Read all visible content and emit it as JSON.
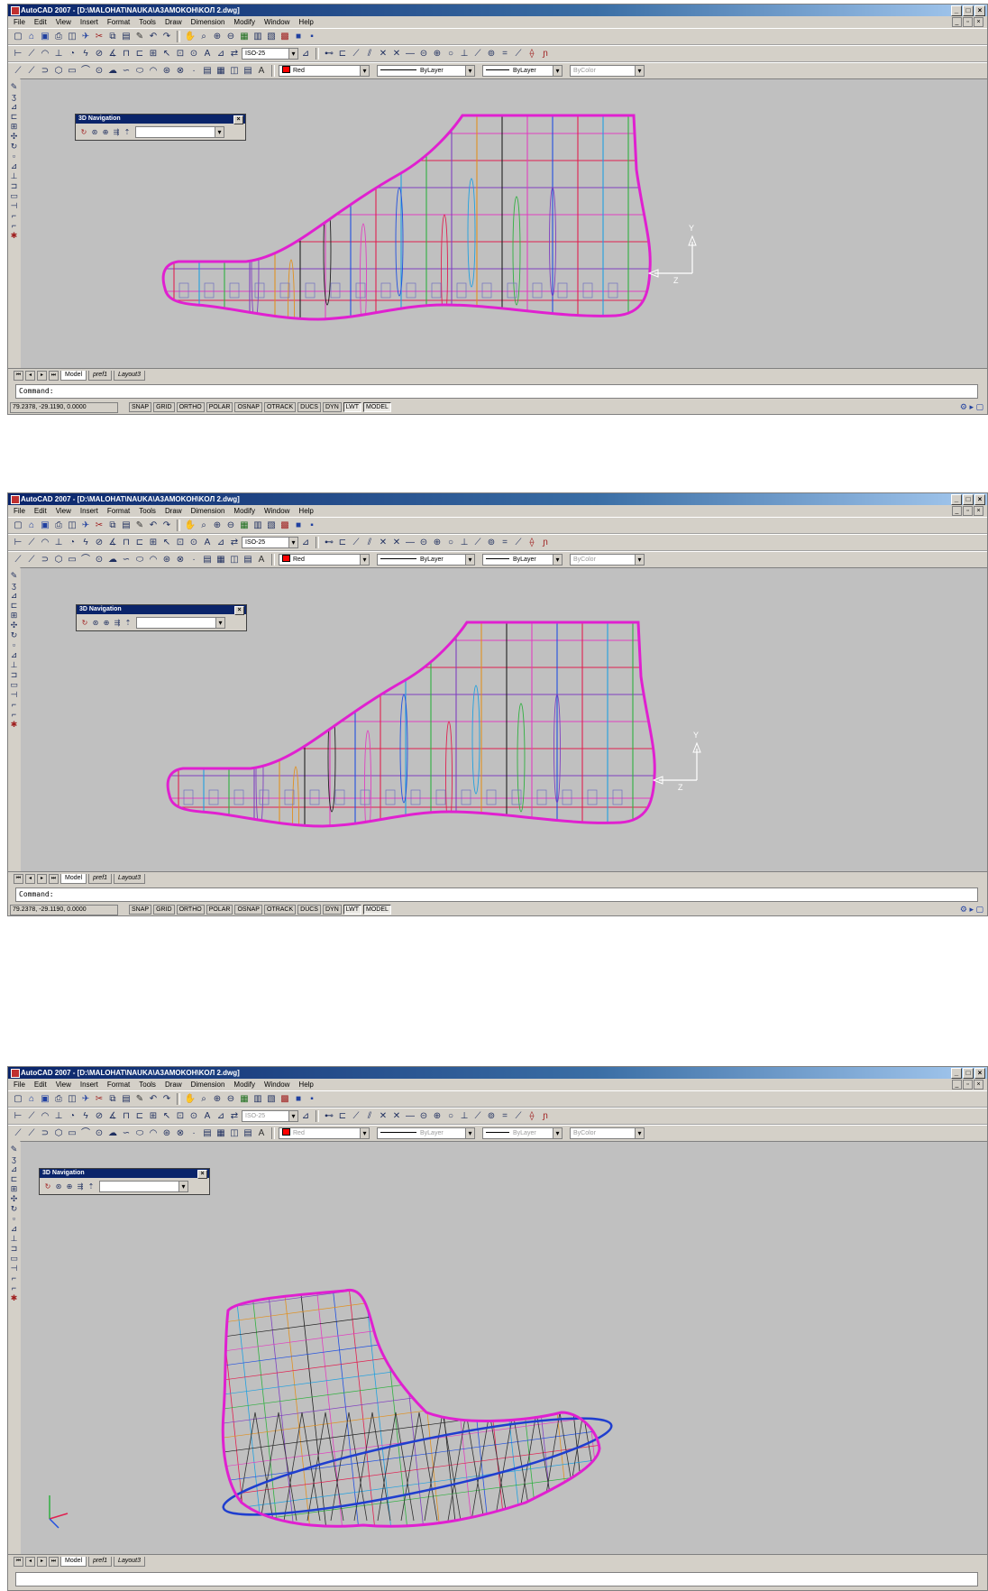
{
  "screens": [
    {
      "title": "AutoCAD 2007 - [D:\\MALOHAT\\NAUKA\\A3AMOKOH\\KOЛ 2.dwg]",
      "menu": [
        "File",
        "Edit",
        "View",
        "Insert",
        "Format",
        "Tools",
        "Draw",
        "Dimension",
        "Modify",
        "Window",
        "Help"
      ],
      "dimstyle": "ISO-25",
      "color": "Red",
      "linetype": "ByLayer",
      "lineweight": "ByLayer",
      "plotstyle": "ByColor",
      "nav_title": "3D Navigation",
      "tabs": [
        "Model",
        "pref1",
        "Layout3"
      ],
      "command": "Command:",
      "coords": "79.2378, -29.1190, 0.0000",
      "status": [
        "SNAP",
        "GRID",
        "ORTHO",
        "POLAR",
        "OSNAP",
        "OTRACK",
        "DUCS",
        "DYN",
        "LWT",
        "MODEL"
      ],
      "ucs": {
        "y": "Y",
        "z": "Z"
      }
    },
    {
      "title": "AutoCAD 2007 - [D:\\MALOHAT\\NAUKA\\A3AMOKOH\\KOЛ 2.dwg]",
      "menu": [
        "File",
        "Edit",
        "View",
        "Insert",
        "Format",
        "Tools",
        "Draw",
        "Dimension",
        "Modify",
        "Window",
        "Help"
      ],
      "dimstyle": "ISO-25",
      "color": "Red",
      "linetype": "ByLayer",
      "lineweight": "ByLayer",
      "plotstyle": "ByColor",
      "nav_title": "3D Navigation",
      "tabs": [
        "Model",
        "pref1",
        "Layout3"
      ],
      "command": "Command:",
      "coords": "79.2378, -29.1190, 0.0000",
      "status": [
        "SNAP",
        "GRID",
        "ORTHO",
        "POLAR",
        "OSNAP",
        "OTRACK",
        "DUCS",
        "DYN",
        "LWT",
        "MODEL"
      ],
      "ucs": {
        "y": "Y",
        "z": "Z"
      }
    },
    {
      "title": "AutoCAD 2007 - [D:\\MALOHAT\\NAUKA\\A3AMOKOH\\KOЛ 2.dwg]",
      "menu": [
        "File",
        "Edit",
        "View",
        "Insert",
        "Format",
        "Tools",
        "Draw",
        "Dimension",
        "Modify",
        "Window",
        "Help"
      ],
      "dimstyle": "ISO-25",
      "color": "Red",
      "linetype": "ByLayer",
      "lineweight": "ByLayer",
      "plotstyle": "ByColor",
      "nav_title": "3D Navigation",
      "tabs": [
        "Model",
        "pref1",
        "Layout3"
      ]
    }
  ],
  "colors": {
    "outline": "#e020d0",
    "ellipse": "#1f3ecf",
    "section_colors": [
      "#e02050",
      "#20a0e0",
      "#30b040",
      "#8040c0",
      "#e09020",
      "#202020",
      "#e040c0",
      "#2050e0"
    ]
  }
}
